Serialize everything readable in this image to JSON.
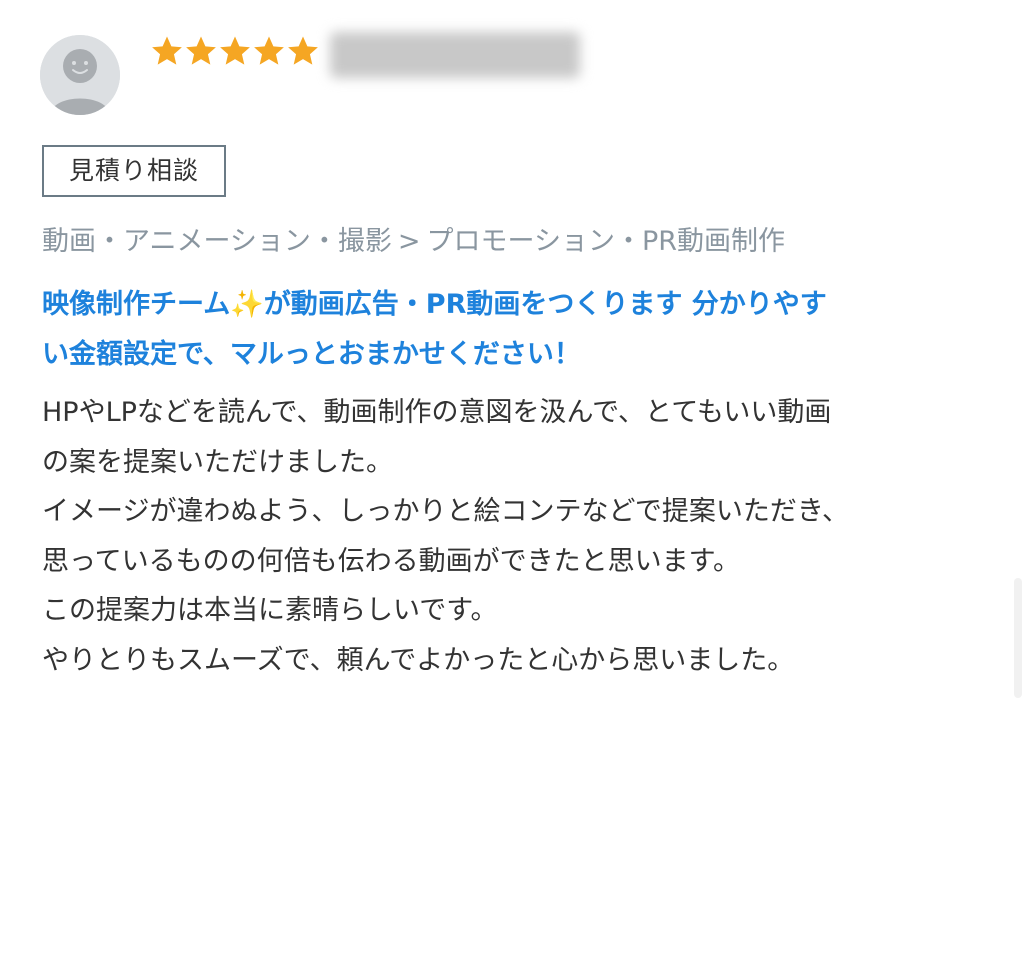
{
  "review": {
    "rating": 5,
    "rating_max": 5,
    "star_color": "#f5a623",
    "username": "",
    "tag": "見積り相談",
    "breadcrumb": {
      "category": "動画・アニメーション・撮影",
      "separator": ">",
      "subcategory": "プロモーション・PR動画制作"
    },
    "title_line1": "映像制作チーム✨が動画広告・PR動画をつくります 分かりやす",
    "title_line2": "い金額設定で、マルっとおまかせください！",
    "title_color": "#1e82dc",
    "body_lines": [
      "HPやLPなどを読んで、動画制作の意図を汲んで、とてもいい動画",
      "の案を提案いただけました。",
      "イメージが違わぬよう、しっかりと絵コンテなどで提案いただき、",
      "思っているものの何倍も伝わる動画ができたと思います。",
      "この提案力は本当に素晴らしいです。",
      "やりとりもスムーズで、頼んでよかったと心から思いました。"
    ]
  }
}
